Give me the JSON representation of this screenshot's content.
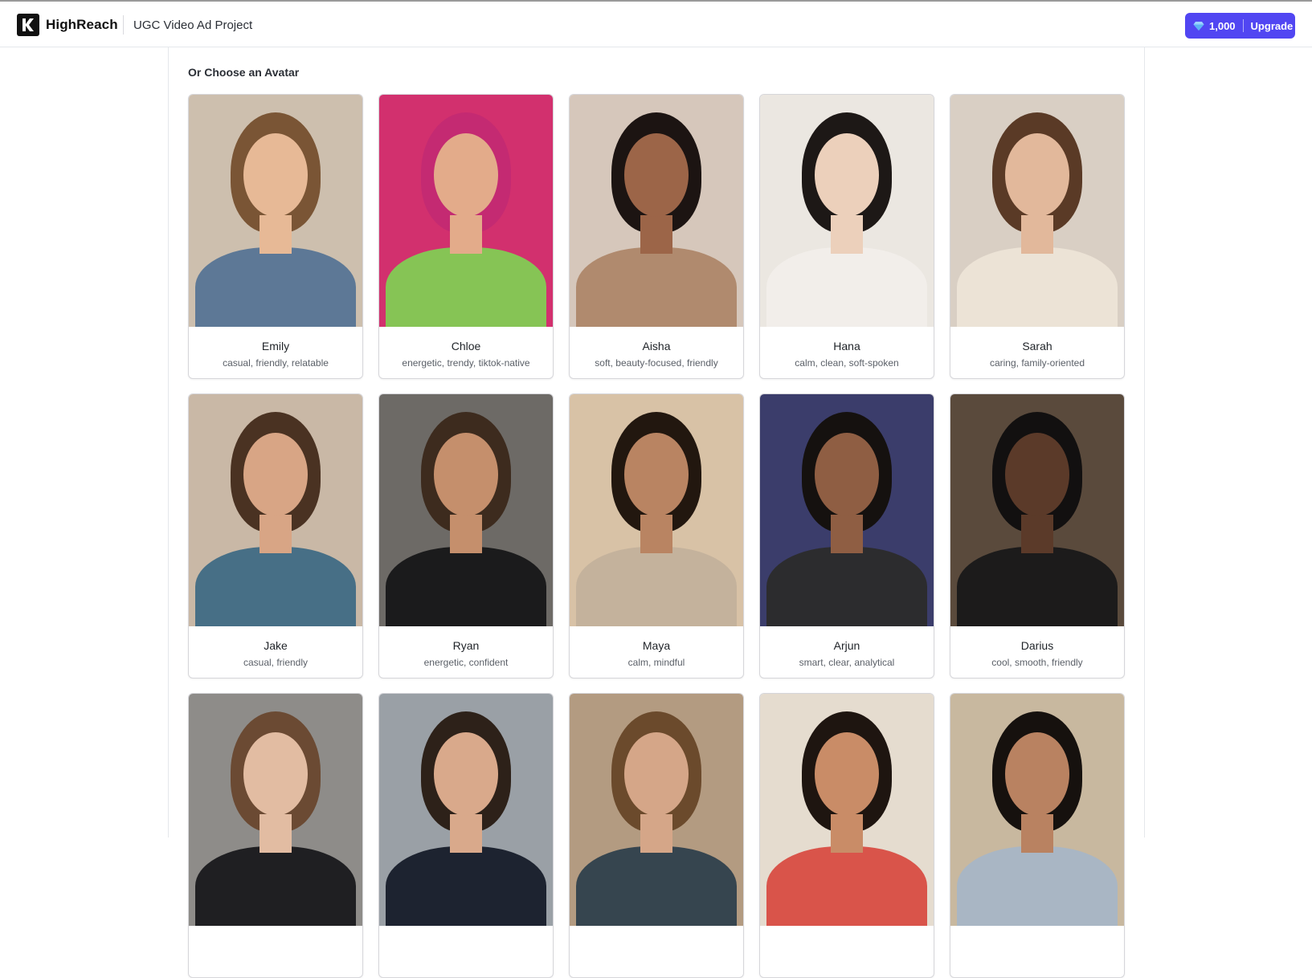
{
  "header": {
    "brand": "HighReach",
    "project_title": "UGC Video Ad Project",
    "credits": "1,000",
    "upgrade_label": "Upgrade",
    "icons": [
      "highreach-logo-icon",
      "gem-icon"
    ],
    "accent_color": "#5146f2"
  },
  "section": {
    "title": "Or Choose an Avatar"
  },
  "avatars": [
    {
      "name": "Emily",
      "tags": "casual, friendly, relatable",
      "palette": {
        "bg": "#cdbfae",
        "hair": "#7a5535",
        "skin": "#e7b996",
        "shirt": "#5d7896"
      }
    },
    {
      "name": "Chloe",
      "tags": "energetic, trendy, tiktok-native",
      "palette": {
        "bg": "#d2306e",
        "hair": "#c42a72",
        "skin": "#e3ab8a",
        "shirt": "#86c455"
      }
    },
    {
      "name": "Aisha",
      "tags": "soft, beauty-focused, friendly",
      "palette": {
        "bg": "#d6c7bb",
        "hair": "#1c1412",
        "skin": "#9c6548",
        "shirt": "#b08a6e"
      }
    },
    {
      "name": "Hana",
      "tags": "calm, clean, soft-spoken",
      "palette": {
        "bg": "#ebe7e1",
        "hair": "#1d1816",
        "skin": "#ecd0bb",
        "shirt": "#f2eeea"
      }
    },
    {
      "name": "Sarah",
      "tags": "caring, family-oriented",
      "palette": {
        "bg": "#d9cfc4",
        "hair": "#5a3a26",
        "skin": "#e2b89b",
        "shirt": "#ece3d6"
      }
    },
    {
      "name": "Jake",
      "tags": "casual, friendly",
      "palette": {
        "bg": "#c9b8a6",
        "hair": "#4a3222",
        "skin": "#d8a585",
        "shirt": "#476f86"
      }
    },
    {
      "name": "Ryan",
      "tags": "energetic, confident",
      "palette": {
        "bg": "#6d6a66",
        "hair": "#3d2b1e",
        "skin": "#c58f6c",
        "shirt": "#1b1b1c"
      }
    },
    {
      "name": "Maya",
      "tags": "calm, mindful",
      "palette": {
        "bg": "#d8c2a6",
        "hair": "#22170f",
        "skin": "#b98462",
        "shirt": "#c4b29c"
      }
    },
    {
      "name": "Arjun",
      "tags": "smart, clear, analytical",
      "palette": {
        "bg": "#3b3d6b",
        "hair": "#15110f",
        "skin": "#8f5e43",
        "shirt": "#2c2c2e"
      }
    },
    {
      "name": "Darius",
      "tags": "cool, smooth, friendly",
      "palette": {
        "bg": "#5a4a3c",
        "hair": "#121010",
        "skin": "#5b3a29",
        "shirt": "#1c1b1b"
      }
    },
    {
      "name": "",
      "tags": "",
      "palette": {
        "bg": "#8e8c89",
        "hair": "#6b4a33",
        "skin": "#e2bca2",
        "shirt": "#1f1f22"
      }
    },
    {
      "name": "",
      "tags": "",
      "palette": {
        "bg": "#9aa0a6",
        "hair": "#2d2119",
        "skin": "#d9a98b",
        "shirt": "#1d2330"
      }
    },
    {
      "name": "",
      "tags": "",
      "palette": {
        "bg": "#b39b81",
        "hair": "#6b4a2c",
        "skin": "#d5a688",
        "shirt": "#36454f"
      }
    },
    {
      "name": "",
      "tags": "",
      "palette": {
        "bg": "#e5dccf",
        "hair": "#1e1510",
        "skin": "#c98c67",
        "shirt": "#d9544a"
      }
    },
    {
      "name": "",
      "tags": "",
      "palette": {
        "bg": "#c8b89f",
        "hair": "#16110e",
        "skin": "#b98261",
        "shirt": "#a9b6c4"
      }
    }
  ]
}
